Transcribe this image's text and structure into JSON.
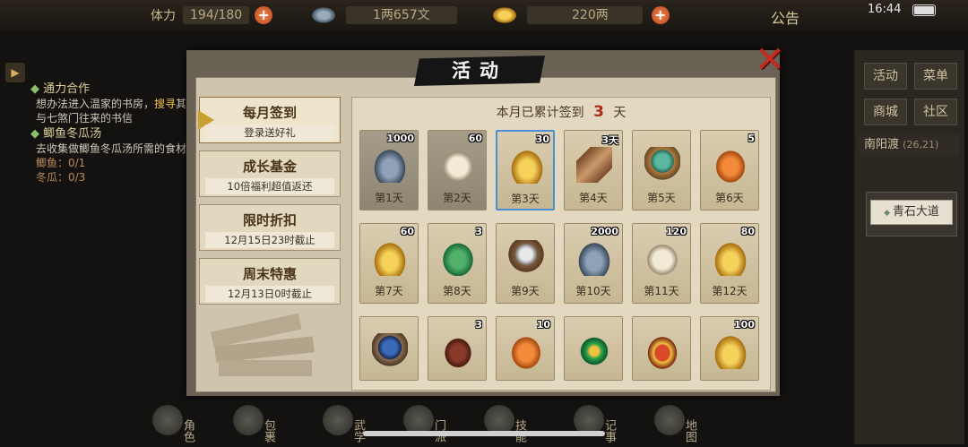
{
  "topbar": {
    "stamina_label": "体力",
    "stamina_value": "194/180",
    "silver_value": "1两657文",
    "gold_value": "220两",
    "plus_symbol": "+",
    "notice": "公告",
    "clock": "16:44"
  },
  "quests": [
    {
      "title": "通力合作",
      "lines": [
        "想办法进入温家的书房，",
        "搜寻",
        "其与七煞门往来的书信"
      ]
    },
    {
      "title": "鲫鱼冬瓜汤",
      "text": "去收集做鲫鱼冬瓜汤所需的食材",
      "counts": [
        "鲫鱼：0/1",
        "冬瓜：0/3"
      ]
    }
  ],
  "quest_text": {
    "q1_a": "想办法进入温家的书房，",
    "q1_hl": "搜寻",
    "q1_b": "其与七煞门往来的书信",
    "q2_text": "去收集做鲫鱼冬瓜汤所需的食材",
    "q2_c1": "鲫鱼：0/1",
    "q2_c2": "冬瓜：0/3"
  },
  "right": {
    "buttons": [
      "活动",
      "菜单",
      "商城",
      "社区"
    ],
    "location_name": "南阳渡",
    "location_coord": "(26,21)",
    "place_label": "青石大道"
  },
  "dialog": {
    "title": "活动",
    "close_symbol": "✕",
    "tabs": [
      {
        "title": "每月签到",
        "sub": "登录送好礼",
        "active": true
      },
      {
        "title": "成长基金",
        "sub": "10倍福利超值返还",
        "active": false
      },
      {
        "title": "限时折扣",
        "sub": "12月15日23时截止",
        "active": false
      },
      {
        "title": "周末特惠",
        "sub": "12月13日0时截止",
        "active": false
      }
    ],
    "header_prefix": "本月已累计签到",
    "header_count": "3",
    "header_suffix": "天",
    "days": [
      {
        "label": "第1天",
        "count": "1000",
        "item": "silver",
        "state": "claimed"
      },
      {
        "label": "第2天",
        "count": "60",
        "item": "bun",
        "state": "claimed"
      },
      {
        "label": "第3天",
        "count": "30",
        "item": "gold",
        "state": "today"
      },
      {
        "label": "第4天",
        "count": "3天",
        "item": "token",
        "state": "normal"
      },
      {
        "label": "第5天",
        "count": "",
        "item": "orb",
        "state": "normal"
      },
      {
        "label": "第6天",
        "count": "5",
        "item": "orange",
        "state": "normal"
      },
      {
        "label": "第7天",
        "count": "60",
        "item": "gold",
        "state": "normal"
      },
      {
        "label": "第8天",
        "count": "3",
        "item": "leaf",
        "state": "normal"
      },
      {
        "label": "第9天",
        "count": "",
        "item": "pearl",
        "state": "normal"
      },
      {
        "label": "第10天",
        "count": "2000",
        "item": "silver",
        "state": "normal"
      },
      {
        "label": "第11天",
        "count": "120",
        "item": "bun",
        "state": "normal"
      },
      {
        "label": "第12天",
        "count": "80",
        "item": "gold",
        "state": "normal"
      },
      {
        "label": "",
        "count": "",
        "item": "blueorb",
        "state": "normal"
      },
      {
        "label": "",
        "count": "3",
        "item": "jar",
        "state": "normal"
      },
      {
        "label": "",
        "count": "10",
        "item": "orange",
        "state": "normal"
      },
      {
        "label": "",
        "count": "",
        "item": "jade",
        "state": "normal"
      },
      {
        "label": "",
        "count": "",
        "item": "box",
        "state": "normal"
      },
      {
        "label": "",
        "count": "100",
        "item": "gold",
        "state": "normal"
      }
    ]
  },
  "bottom_nav": [
    "角色",
    "包裹",
    "武学",
    "门派",
    "技能",
    "记事",
    "地图"
  ]
}
